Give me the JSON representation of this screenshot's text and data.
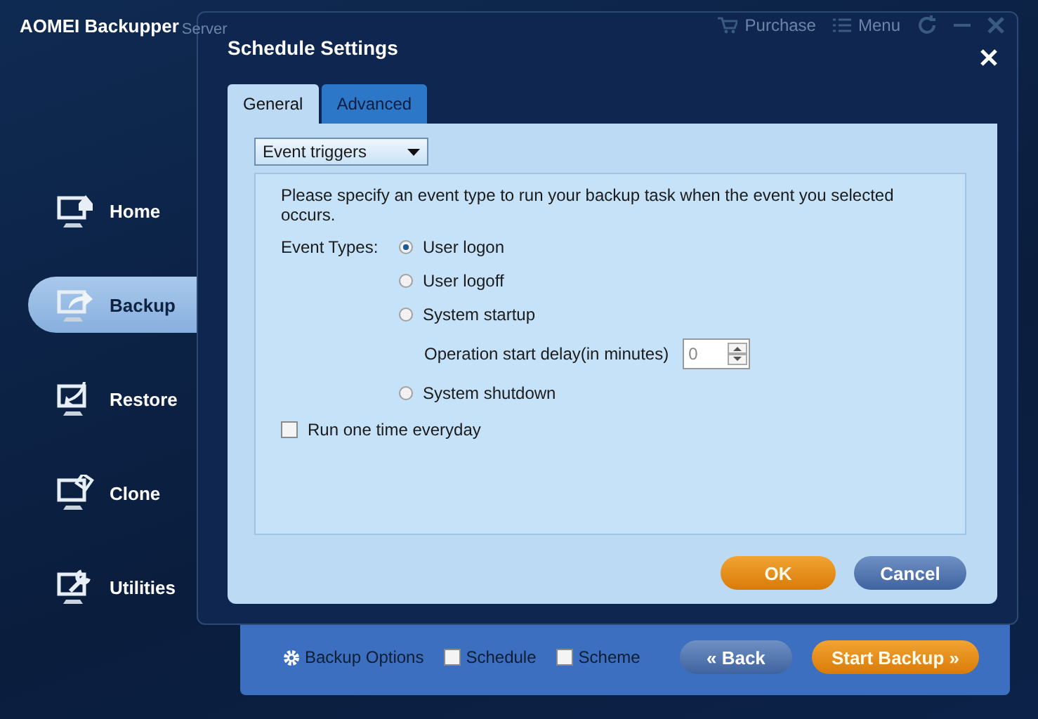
{
  "app": {
    "title": "AOMEI Backupper",
    "edition": "Server",
    "top_actions": [
      {
        "label": "Purchase",
        "kind": "cart"
      },
      {
        "label": "Menu",
        "kind": "menu"
      }
    ]
  },
  "sidebar": {
    "items": [
      {
        "label": "Home",
        "kind": "home",
        "selected": false
      },
      {
        "label": "Backup",
        "kind": "backup",
        "selected": true
      },
      {
        "label": "Restore",
        "kind": "restore",
        "selected": false
      },
      {
        "label": "Clone",
        "kind": "clone",
        "selected": false
      },
      {
        "label": "Utilities",
        "kind": "utilities",
        "selected": false
      }
    ]
  },
  "bottom_bar": {
    "options_label": "Backup Options",
    "checks": [
      {
        "label": "Schedule",
        "checked": false
      },
      {
        "label": "Scheme",
        "checked": false
      }
    ],
    "back": "« Back",
    "start": "Start Backup »"
  },
  "dialog": {
    "title": "Schedule Settings",
    "tabs": [
      {
        "label": "General",
        "selected": true
      },
      {
        "label": "Advanced",
        "selected": false
      }
    ],
    "mode": "Event triggers",
    "description": "Please specify an event type to run your backup task when the event you selected occurs.",
    "event_types_label": "Event Types:",
    "events": [
      {
        "label": "User logon",
        "selected": true
      },
      {
        "label": "User logoff",
        "selected": false
      },
      {
        "label": "System startup",
        "selected": false,
        "delay": {
          "label": "Operation start delay(in minutes)",
          "value": "0"
        }
      },
      {
        "label": "System shutdown",
        "selected": false
      }
    ],
    "run_once": {
      "label": "Run one time everyday",
      "checked": false
    },
    "buttons": [
      {
        "label": "OK",
        "kind": "primary"
      },
      {
        "label": "Cancel",
        "kind": "secondary"
      }
    ]
  }
}
